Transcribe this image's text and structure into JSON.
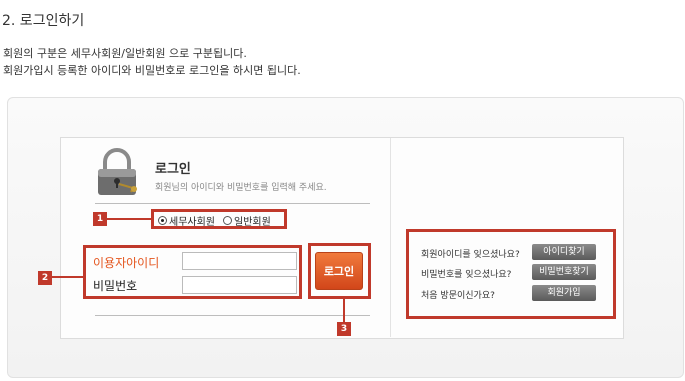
{
  "section": {
    "heading": "2. 로그인하기",
    "desc_line1": "회원의 구분은 세무사회원/일반회원 으로 구분됩니다.",
    "desc_line2": "회원가입시 등록한 아이디와 비밀번호로 로그인을 하시면 됩니다."
  },
  "login": {
    "title": "로그인",
    "subtitle": "회원님의 아이디와 비밀번호를 입력해 주세요.",
    "radio_options": [
      {
        "label": "세무사회원",
        "selected": true
      },
      {
        "label": "일반회원",
        "selected": false
      }
    ],
    "id_label": "이용자아이디",
    "pw_label": "비밀번호",
    "id_value": "",
    "pw_value": "",
    "button_label": "로그인"
  },
  "help": {
    "items": [
      {
        "question": "회원아이디를 잊으셨나요?",
        "button": "아이디찾기"
      },
      {
        "question": "비밀번호를 잊으셨나요?",
        "button": "비밀번호찾기"
      },
      {
        "question": "처음 방문이신가요?",
        "button": "회원가입"
      }
    ]
  },
  "markers": [
    "1",
    "2",
    "3"
  ],
  "colors": {
    "accent_orange": "#e4561f",
    "annotation_red": "#c0392b",
    "label_orange": "#e4561f"
  }
}
